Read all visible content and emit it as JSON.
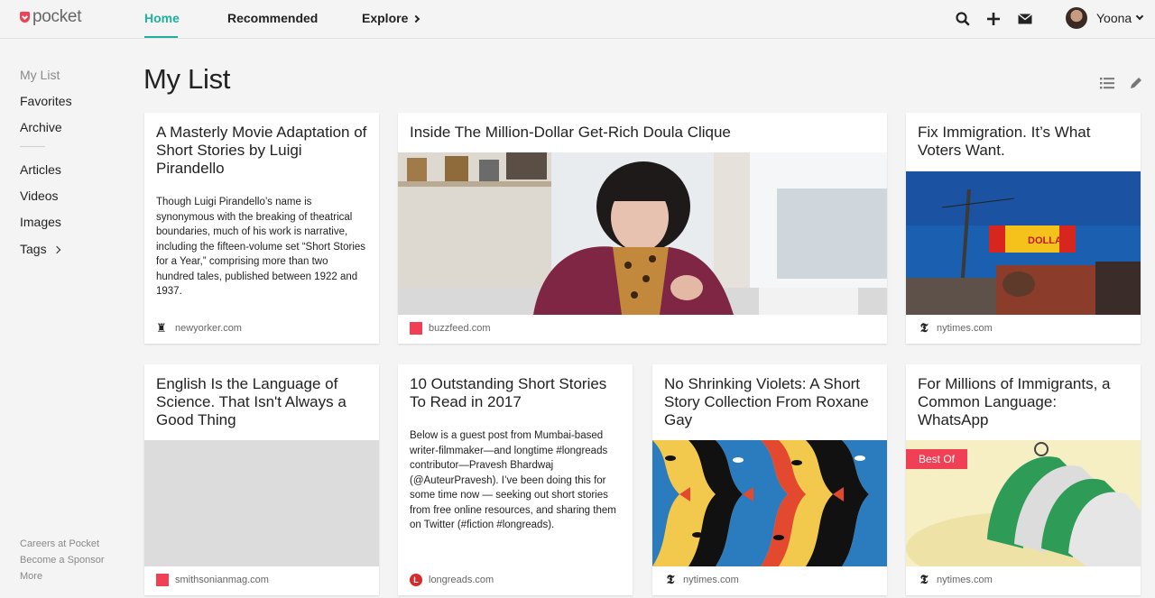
{
  "app": {
    "logo_text": "pocket",
    "brand_color": "#ef4056",
    "accent_color": "#1eb19b"
  },
  "nav": {
    "tabs": [
      {
        "label": "Home",
        "active": true
      },
      {
        "label": "Recommended",
        "active": false
      },
      {
        "label": "Explore",
        "active": false
      }
    ],
    "icons": [
      "search-icon",
      "add-icon",
      "mail-icon"
    ],
    "user": {
      "name": "Yoona"
    }
  },
  "sidebar": {
    "items": [
      {
        "label": "My List",
        "active": true
      },
      {
        "label": "Favorites"
      },
      {
        "label": "Archive"
      },
      {
        "label": "Articles"
      },
      {
        "label": "Videos"
      },
      {
        "label": "Images"
      },
      {
        "label": "Tags"
      }
    ],
    "footer": [
      "Careers at Pocket",
      "Become a Sponsor",
      "More"
    ]
  },
  "main": {
    "title": "My List",
    "view_icons": [
      "list-view-icon",
      "edit-icon"
    ],
    "cards": [
      {
        "title": "A Masterly Movie Adaptation of Short Stories by Luigi Pirandello",
        "excerpt": "Though Luigi Pirandello’s name is synonymous with the breaking of theatrical boundaries, much of his work is narrative, including the fifteen-volume set “Short Stories for a Year,” comprising more than two hundred tales, published between 1922 and 1937.",
        "source": "newyorker.com",
        "favicon": "newyorker-icon"
      },
      {
        "title": "Inside The Million-Dollar Get-Rich Doula Clique",
        "image": "photo of woman in burgundy jacket and leopard scarf",
        "source": "buzzfeed.com",
        "favicon": "buzzfeed-icon"
      },
      {
        "title": "Fix Immigration. It’s What Voters Want.",
        "image": "photo of street with billboard",
        "billboard_text": "DOLLAR.",
        "source": "nytimes.com",
        "favicon": "nytimes-icon"
      },
      {
        "title": "English Is the Language of Science. That Isn't Always a Good Thing",
        "image": "grey placeholder",
        "source": "smithsonianmag.com",
        "favicon": "smithsonian-icon"
      },
      {
        "title": "10 Outstanding Short Stories To Read in 2017",
        "excerpt": "Below is a guest post from Mumbai-based writer-filmmaker—and longtime #longreads contributor—Pravesh Bhardwaj (@AuteurPravesh). I’ve been doing this for some time now — seeking out short stories from free online resources, and sharing them on Twitter (#fiction #longreads).",
        "source": "longreads.com",
        "favicon": "longreads-icon"
      },
      {
        "title": "No Shrinking Violets: A Short Story Collection From Roxane Gay",
        "image": "illustration of repeated colorful face profiles",
        "source": "nytimes.com",
        "favicon": "nytimes-icon"
      },
      {
        "title": "For Millions of Immigrants, a Common Language: WhatsApp",
        "badge": "Best Of",
        "image": "illustration of green speech bubbles",
        "source": "nytimes.com",
        "favicon": "nytimes-icon"
      }
    ]
  }
}
